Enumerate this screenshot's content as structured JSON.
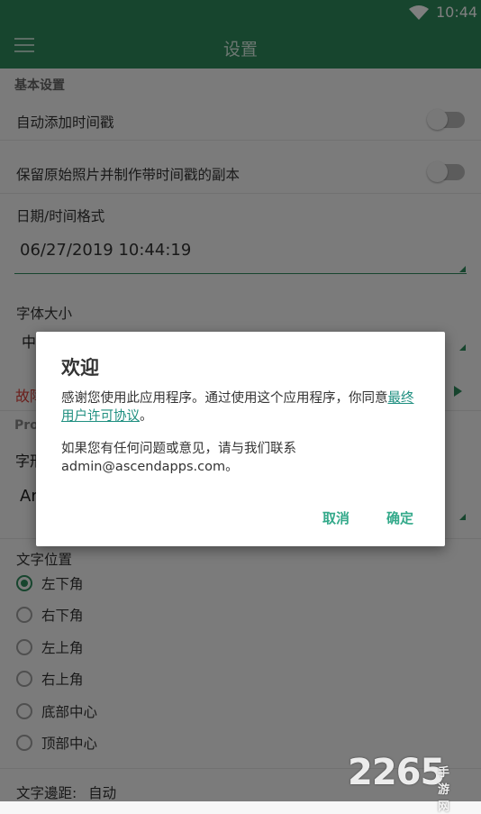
{
  "status_bar": {
    "time": "10:44",
    "wifi_icon": "wifi-icon"
  },
  "app_bar": {
    "title": "设置",
    "menu_icon": "menu-icon"
  },
  "settings": {
    "section_basic": "基本设置",
    "auto_timestamp_label": "自动添加时间戳",
    "keep_original_label": "保留原始照片并制作带时间戳的副本",
    "date_format_label": "日期/时间格式",
    "date_format_value": "06/27/2019 10:44:19",
    "font_size_label": "字体大小",
    "font_size_value_partial": "中",
    "troubleshoot_partial": "故障",
    "pro_section_partial": "Pro",
    "font_label_partial": "字形",
    "font_value_partial": "Ar",
    "text_position_label": "文字位置",
    "positions": [
      "左下角",
      "右下角",
      "左上角",
      "右上角",
      "底部中心",
      "顶部中心"
    ],
    "selected_position": "左下角",
    "text_margin_label": "文字邊距:",
    "text_margin_value": "自动"
  },
  "dialog": {
    "title": "欢迎",
    "body_text": "感谢您使用此应用程序。通过使用这个应用程序，你同意",
    "eula_link": "最终用户许可协议",
    "body_end": "。",
    "contact_text": "如果您有任何问题或意见，请与我们联系admin@ascendapps.com。",
    "cancel_label": "取消",
    "ok_label": "确定"
  },
  "watermark": {
    "number": "2265",
    "text": "手游网"
  },
  "colors": {
    "primary": "#2e8a5c",
    "accent": "#33a98a",
    "link": "#1f8f80"
  }
}
